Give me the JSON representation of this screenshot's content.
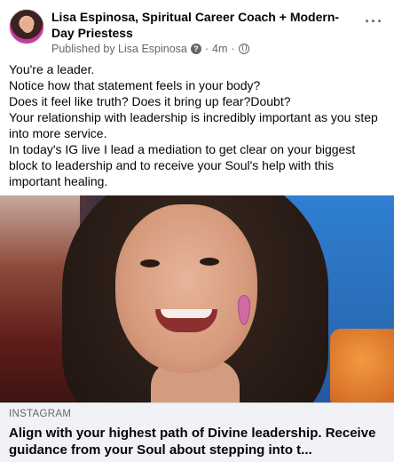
{
  "post": {
    "author": "Lisa Espinosa, Spiritual Career Coach + Modern-Day Priestess",
    "published_by": "Published by Lisa Espinosa",
    "badge_glyph": "?",
    "separator": "·",
    "time": "4m",
    "more_glyph": "···",
    "text_lines": [
      "You're a leader.",
      "Notice how that statement feels in your body?",
      "Does it feel like truth? Does it bring up fear?Doubt?",
      "Your relationship with leadership is incredibly important as you step into more service.",
      "In today's IG live I lead a mediation to get clear on your biggest block to leadership and to receive your Soul's help with this important healing."
    ]
  },
  "link": {
    "domain": "INSTAGRAM",
    "title": "Align with your highest path of Divine leadership. Receive guidance from your Soul about stepping into t..."
  },
  "colors": {
    "text_primary": "#050505",
    "text_secondary": "#65676b",
    "preview_bg": "#f0f2f5"
  },
  "icons": [
    "avatar",
    "question-badge-icon",
    "globe-icon",
    "more-options-icon"
  ]
}
